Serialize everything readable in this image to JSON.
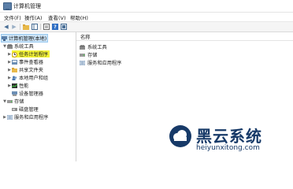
{
  "window": {
    "title": "计算机管理"
  },
  "menu": [
    "文件(F)",
    "操作(A)",
    "查看(V)",
    "帮助(H)"
  ],
  "toolbar": {
    "icons": [
      "back-icon",
      "forward-icon",
      "up-folder-icon",
      "show-tree-icon",
      "properties-icon",
      "help-icon",
      "console-icon"
    ]
  },
  "tree": {
    "root": "计算机管理(本地)",
    "system_tools": "系统工具",
    "task_scheduler": "任务计划程序",
    "event_viewer": "事件查看器",
    "shared_folders": "共享文件夹",
    "local_users": "本地用户和组",
    "performance": "性能",
    "device_manager": "设备管理器",
    "storage": "存储",
    "disk_management": "磁盘管理",
    "services_apps": "服务和应用程序"
  },
  "list": {
    "column_name": "名称",
    "items": [
      "系统工具",
      "存储",
      "服务和应用程序"
    ]
  },
  "watermark": {
    "brand": "黑云系统",
    "url": "heiyunxitong.com"
  },
  "colors": {
    "selection": "#cce4f7",
    "highlight": "#f5f538",
    "folder": "#e8b94a",
    "watermark": "#173a68"
  }
}
